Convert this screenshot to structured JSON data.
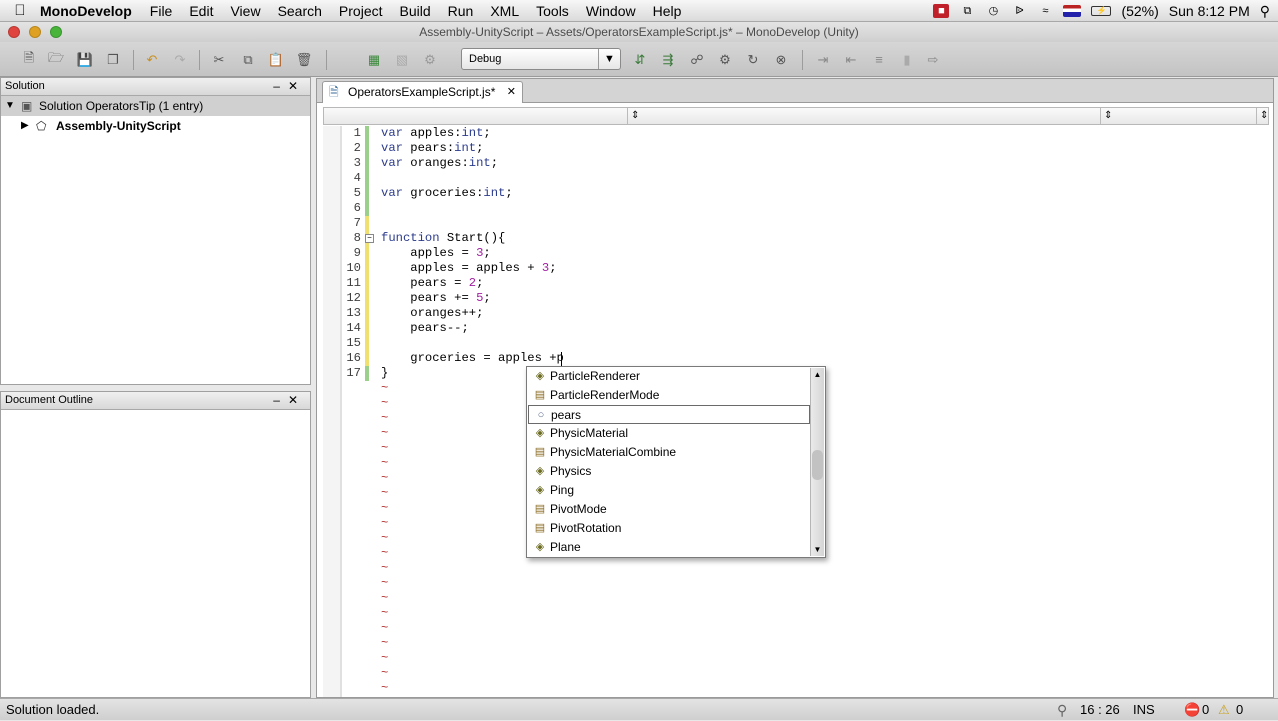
{
  "menubar": {
    "app_name": "MonoDevelop",
    "items": [
      "File",
      "Edit",
      "View",
      "Search",
      "Project",
      "Build",
      "Run",
      "XML",
      "Tools",
      "Window",
      "Help"
    ],
    "battery": "(52%)",
    "clock": "Sun 8:12 PM"
  },
  "window": {
    "title": "Assembly-UnityScript – Assets/OperatorsExampleScript.js* – MonoDevelop (Unity)"
  },
  "toolbar": {
    "configuration": "Debug"
  },
  "solution_pad": {
    "title": "Solution",
    "solution_label": "Solution OperatorsTip (1 entry)",
    "project_label": "Assembly-UnityScript"
  },
  "outline_pad": {
    "title": "Document Outline"
  },
  "editor": {
    "tab_label": "OperatorsExampleScript.js*",
    "lines": [
      {
        "n": "1",
        "tokens": [
          {
            "t": "var",
            "c": "kw"
          },
          {
            "t": " apples:"
          },
          {
            "t": "int",
            "c": "kw"
          },
          {
            "t": ";"
          }
        ]
      },
      {
        "n": "2",
        "tokens": [
          {
            "t": "var",
            "c": "kw"
          },
          {
            "t": " pears:"
          },
          {
            "t": "int",
            "c": "kw"
          },
          {
            "t": ";"
          }
        ]
      },
      {
        "n": "3",
        "tokens": [
          {
            "t": "var",
            "c": "kw"
          },
          {
            "t": " oranges:"
          },
          {
            "t": "int",
            "c": "kw"
          },
          {
            "t": ";"
          }
        ]
      },
      {
        "n": "4",
        "tokens": []
      },
      {
        "n": "5",
        "tokens": [
          {
            "t": "var",
            "c": "kw"
          },
          {
            "t": " groceries:"
          },
          {
            "t": "int",
            "c": "kw"
          },
          {
            "t": ";"
          }
        ]
      },
      {
        "n": "6",
        "tokens": []
      },
      {
        "n": "7",
        "tokens": []
      },
      {
        "n": "8",
        "tokens": [
          {
            "t": "function",
            "c": "kw"
          },
          {
            "t": " Start(){"
          }
        ]
      },
      {
        "n": "9",
        "tokens": [
          {
            "t": "    apples = "
          },
          {
            "t": "3",
            "c": "num"
          },
          {
            "t": ";"
          }
        ]
      },
      {
        "n": "10",
        "tokens": [
          {
            "t": "    apples = apples + "
          },
          {
            "t": "3",
            "c": "num"
          },
          {
            "t": ";"
          }
        ]
      },
      {
        "n": "11",
        "tokens": [
          {
            "t": "    pears = "
          },
          {
            "t": "2",
            "c": "num"
          },
          {
            "t": ";"
          }
        ]
      },
      {
        "n": "12",
        "tokens": [
          {
            "t": "    pears += "
          },
          {
            "t": "5",
            "c": "num"
          },
          {
            "t": ";"
          }
        ]
      },
      {
        "n": "13",
        "tokens": [
          {
            "t": "    oranges++;"
          }
        ]
      },
      {
        "n": "14",
        "tokens": [
          {
            "t": "    pears--;"
          }
        ]
      },
      {
        "n": "15",
        "tokens": []
      },
      {
        "n": "16",
        "tokens": [
          {
            "t": "    groceries = apples +p"
          }
        ]
      },
      {
        "n": "17",
        "tokens": [
          {
            "t": "}"
          }
        ]
      }
    ],
    "tilde": "~",
    "completion_items": [
      {
        "label": "ParticleRenderer",
        "icon": "class-icon"
      },
      {
        "label": "ParticleRenderMode",
        "icon": "enum-icon"
      },
      {
        "label": "pears",
        "icon": "field-icon",
        "selected": true
      },
      {
        "label": "PhysicMaterial",
        "icon": "class-icon"
      },
      {
        "label": "PhysicMaterialCombine",
        "icon": "enum-icon"
      },
      {
        "label": "Physics",
        "icon": "class-icon"
      },
      {
        "label": "Ping",
        "icon": "class-icon"
      },
      {
        "label": "PivotMode",
        "icon": "enum-icon"
      },
      {
        "label": "PivotRotation",
        "icon": "enum-icon"
      },
      {
        "label": "Plane",
        "icon": "class-icon"
      }
    ]
  },
  "statusbar": {
    "message": "Solution loaded.",
    "position": "16 : 26",
    "mode": "INS",
    "errors": "0",
    "warnings": "0"
  }
}
